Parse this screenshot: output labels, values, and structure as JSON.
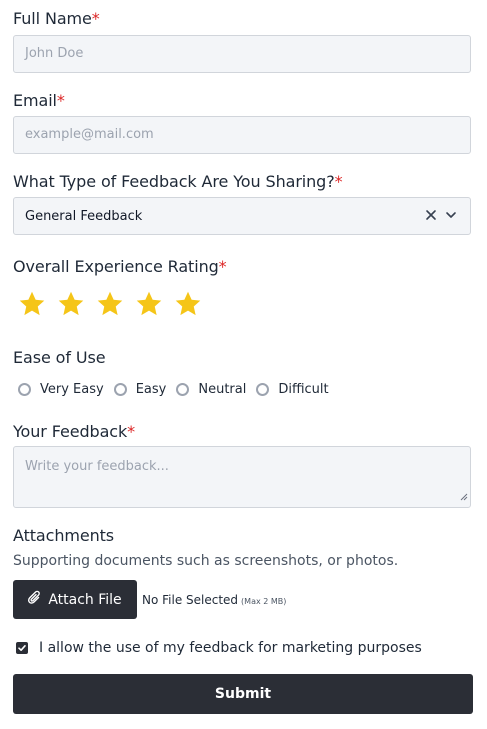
{
  "full_name": {
    "label": "Full Name",
    "required_mark": "*",
    "placeholder": "John Doe"
  },
  "email": {
    "label": "Email",
    "required_mark": "*",
    "placeholder": "example@mail.com"
  },
  "feedback_type": {
    "label": "What Type of Feedback Are You Sharing?",
    "required_mark": "*",
    "selected": "General Feedback",
    "icons": [
      "clear-icon",
      "chevron-down-icon"
    ]
  },
  "rating": {
    "label": "Overall Experience Rating",
    "required_mark": "*",
    "value": 5,
    "max": 5,
    "star_color": "#f5c518",
    "icon": "star-icon"
  },
  "ease_of_use": {
    "label": "Ease of Use",
    "options": [
      "Very Easy",
      "Easy",
      "Neutral",
      "Difficult"
    ]
  },
  "feedback": {
    "label": "Your Feedback",
    "required_mark": "*",
    "placeholder": "Write your feedback..."
  },
  "attachments": {
    "label": "Attachments",
    "helper": "Supporting documents such as screenshots, or photos.",
    "button_label": "Attach File",
    "button_icon": "paperclip-icon",
    "status": "No File Selected",
    "max_note": "(Max 2 MB)"
  },
  "consent": {
    "checked": true,
    "label": "I allow the use of my feedback for marketing purposes"
  },
  "submit": {
    "label": "Submit"
  },
  "colors": {
    "required": "#dc2626",
    "button_bg": "#2b2e36",
    "input_bg": "#f3f5f8"
  }
}
